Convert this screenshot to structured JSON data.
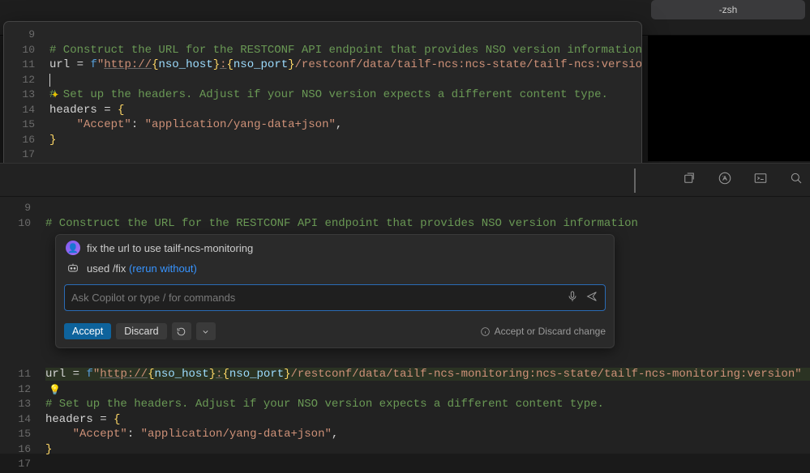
{
  "terminal": {
    "tab_label": "-zsh"
  },
  "popup_editor": {
    "lines": {
      "l9_num": "9",
      "l10_num": "10",
      "l10_comment": "# Construct the URL for the RESTCONF API endpoint that provides NSO version information",
      "l11_num": "11",
      "l11_var": "url",
      "l11_eq": " = ",
      "l11_f": "f",
      "l11_q1": "\"",
      "l11_url": "http://",
      "l11_host": "nso_host",
      "l11_colon": ":",
      "l11_port": "nso_port",
      "l11_path": "/restconf/data/tailf-ncs:ncs-state/tailf-ncs:version",
      "l11_q2": "\"",
      "l12_num": "12",
      "l13_num": "13",
      "l13_comment": "# Set up the headers. Adjust if your NSO version expects a different content type.",
      "l14_num": "14",
      "l14_var": "headers",
      "l14_eq": " = ",
      "l14_brace": "{",
      "l15_num": "15",
      "l15_indent": "    ",
      "l15_key": "\"Accept\"",
      "l15_colon": ": ",
      "l15_val": "\"application/yang-data+json\"",
      "l15_comma": ",",
      "l16_num": "16",
      "l16_brace": "}",
      "l17_num": "17"
    }
  },
  "copilot": {
    "prompt_text": "fix the url to use tailf-ncs-monitoring",
    "used_prefix": "used ",
    "used_cmd": "/fix ",
    "rerun_link": "(rerun without)",
    "input_placeholder": "Ask Copilot or type / for commands",
    "accept_label": "Accept",
    "discard_label": "Discard",
    "hint_text": "Accept or Discard change"
  },
  "bottom_editor": {
    "lines": {
      "l9_num": "9",
      "l10_num": "10",
      "l10_comment": "# Construct the URL for the RESTCONF API endpoint that provides NSO version information",
      "l11_num": "11",
      "l11_var": "url",
      "l11_eq": " = ",
      "l11_f": "f",
      "l11_q1": "\"",
      "l11_url": "http://",
      "l11_host": "nso_host",
      "l11_colon": ":",
      "l11_port": "nso_port",
      "l11_path": "/restconf/data/tailf-ncs-monitoring:ncs-state/tailf-ncs-monitoring:version",
      "l11_q2": "\"",
      "l12_num": "12",
      "l13_num": "13",
      "l13_comment": "# Set up the headers. Adjust if your NSO version expects a different content type.",
      "l14_num": "14",
      "l14_var": "headers",
      "l14_eq": " = ",
      "l14_brace": "{",
      "l15_num": "15",
      "l15_indent": "    ",
      "l15_key": "\"Accept\"",
      "l15_colon": ": ",
      "l15_val": "\"application/yang-data+json\"",
      "l15_comma": ",",
      "l16_num": "16",
      "l16_brace": "}",
      "l17_num": "17"
    }
  }
}
